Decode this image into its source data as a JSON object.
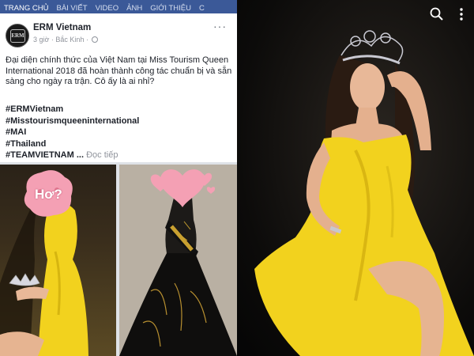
{
  "tabs": [
    {
      "label": "TRANG CHỦ"
    },
    {
      "label": "BÀI VIẾT"
    },
    {
      "label": "VIDEO"
    },
    {
      "label": "ẢNH"
    },
    {
      "label": "GIỚI THIỆU"
    },
    {
      "label": "C"
    }
  ],
  "post": {
    "page_name": "ERM Vietnam",
    "avatar_text": "ERM",
    "time": "3 giờ",
    "location": "Bắc Kinh",
    "more_label": "···",
    "text": "Đại diện chính thức của Việt Nam tại Miss Tourism Queen International 2018 đã hoàn thành công tác chuẩn bị và sẵn sàng cho ngày ra trận. Cô ấy là ai nhỉ?",
    "hashtags": [
      "#ERMVietnam",
      "#Misstourismqueeninternational",
      "#MAI",
      "#Thailand"
    ],
    "last_hashtag": "#TEAMVIETNAM",
    "ellipsis": "...",
    "read_more": "Đọc tiếp"
  },
  "photos": {
    "sticker_text": "Hơ?"
  },
  "viewer": {
    "icons": [
      "search-icon",
      "more-vertical-icon"
    ]
  },
  "colors": {
    "fb_blue": "#3b5998",
    "dress_yellow": "#f2d21e",
    "heart_pink": "#f4a0b4"
  }
}
